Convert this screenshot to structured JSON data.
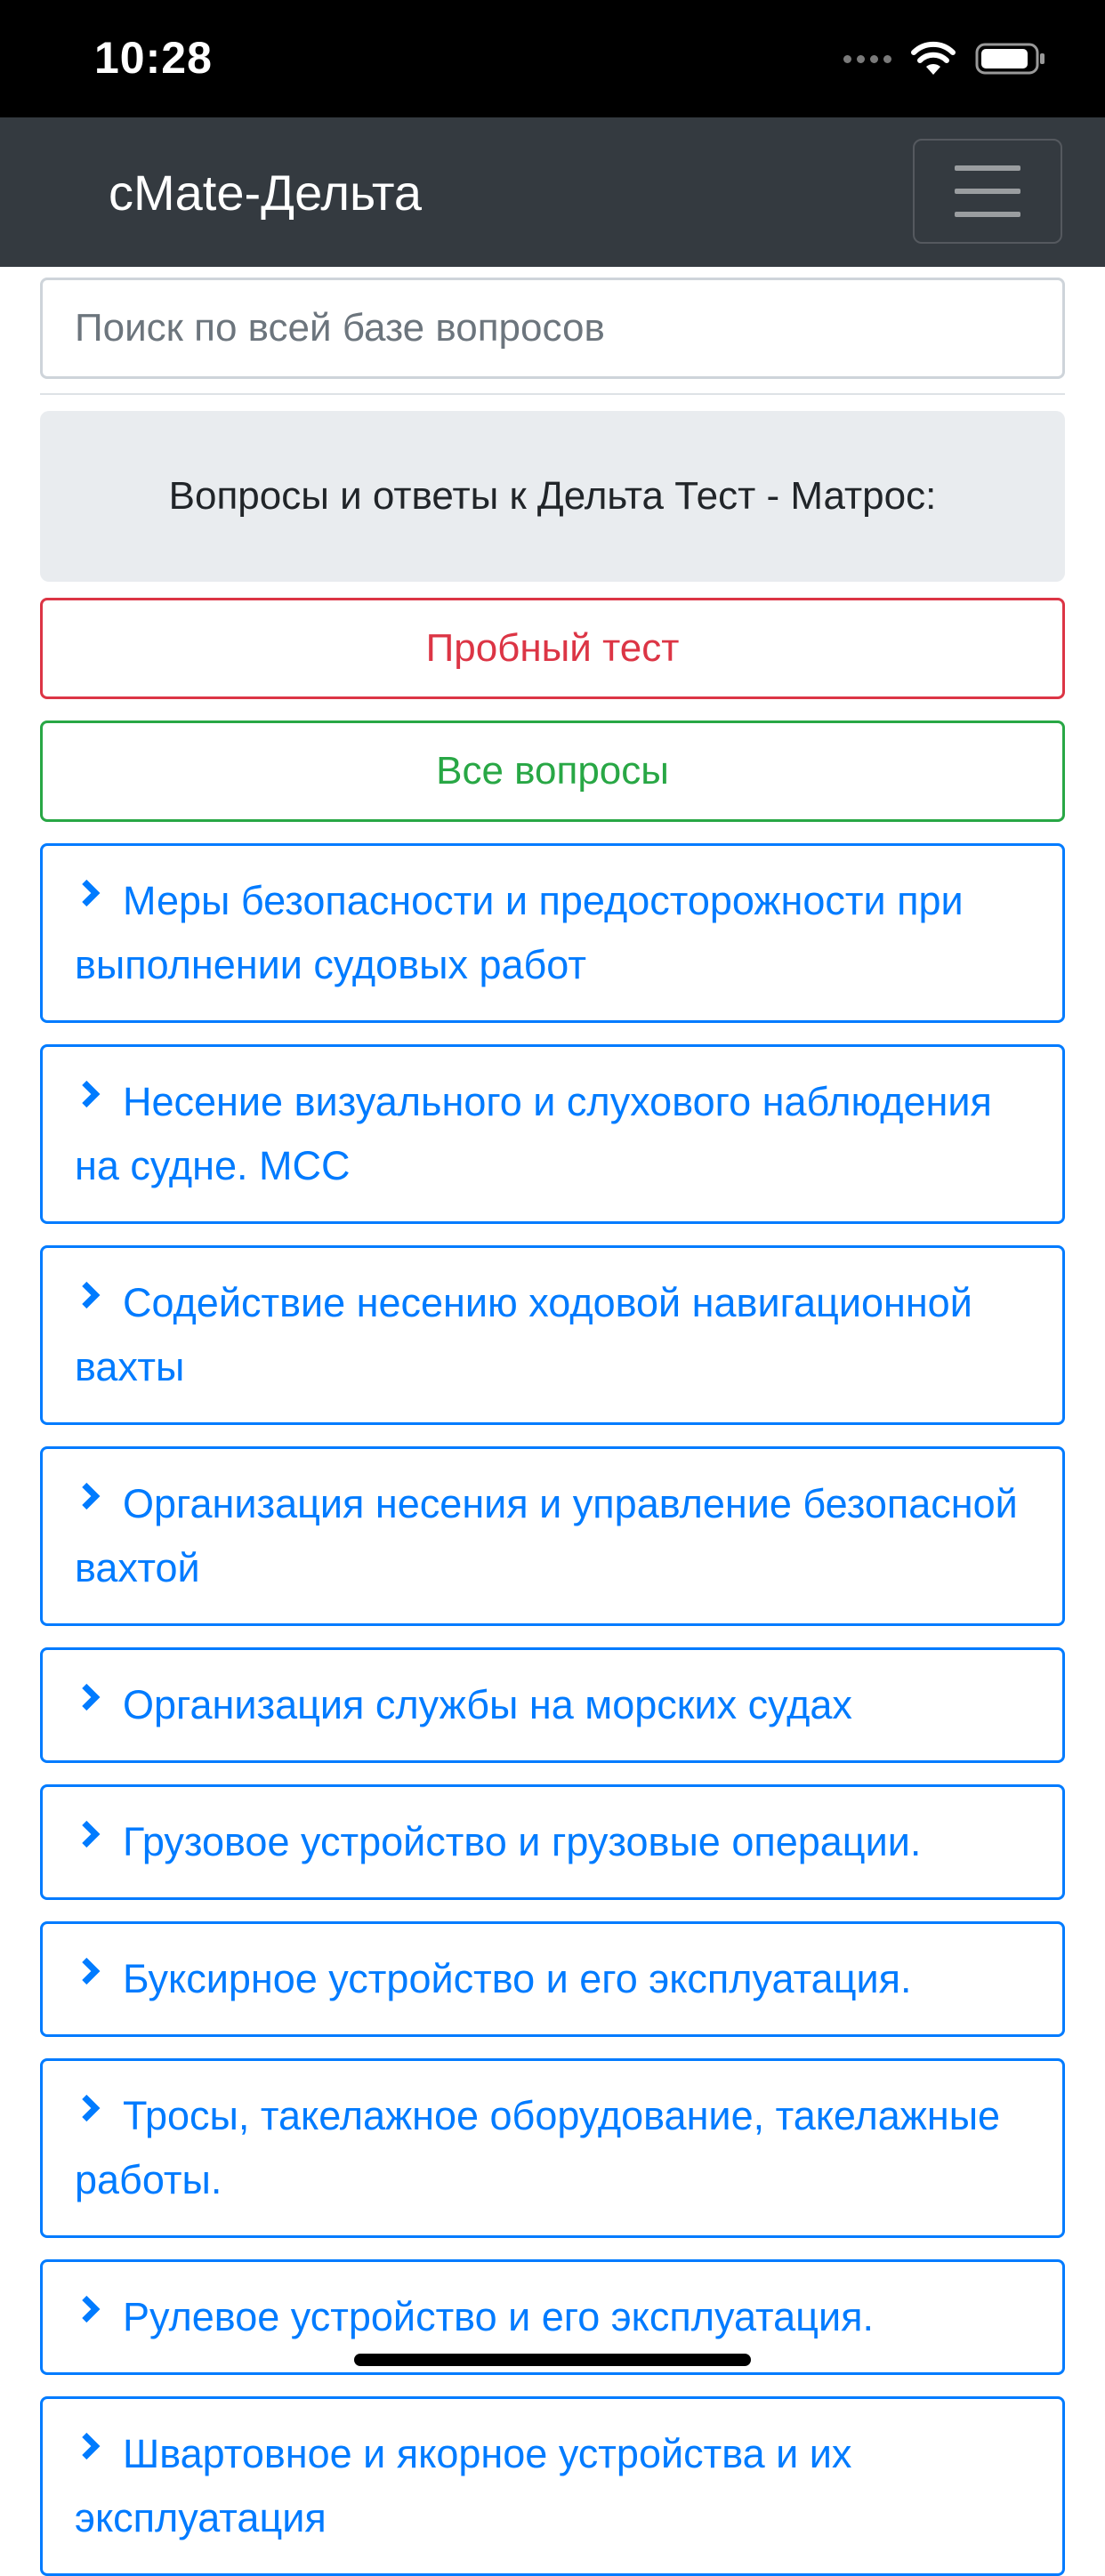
{
  "status_bar": {
    "time": "10:28"
  },
  "navbar": {
    "brand": "сMate-Дельта",
    "toggler_icon": "hamburger-menu-icon"
  },
  "search": {
    "placeholder": "Поиск по всей базе вопросов"
  },
  "header": {
    "text": "Вопросы и ответы к Дельта Тест - Матрос:"
  },
  "buttons": {
    "trial_test": "Пробный тест",
    "all_questions": "Все вопросы"
  },
  "colors": {
    "primary": "#007bff",
    "danger": "#dc3545",
    "success": "#28a745",
    "navbar": "#343a40"
  },
  "topics": [
    {
      "label": "Меры безопасности и предосторожности при выполнении судовых работ"
    },
    {
      "label": "Несение визуального и слухового наблюдения на судне. МСС"
    },
    {
      "label": "Содействие несению ходовой навигационной вахты"
    },
    {
      "label": "Организация несения и управление безопасной вахтой"
    },
    {
      "label": "Организация службы на морских судах"
    },
    {
      "label": "Грузовое устройство и грузовые операции."
    },
    {
      "label": "Буксирное устройство и его эксплуатация."
    },
    {
      "label": "Тросы, такелажное оборудование, такелажные работы."
    },
    {
      "label": "Рулевое устройство и его эксплуатация."
    },
    {
      "label": "Швартовное и якорное устройства и их эксплуатация"
    }
  ]
}
